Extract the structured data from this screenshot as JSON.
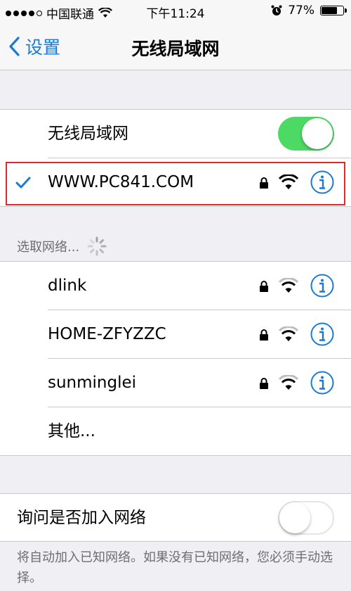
{
  "status_bar": {
    "carrier": "中国联通",
    "time": "下午11:24",
    "battery": "77%",
    "battery_level": 0.77
  },
  "nav": {
    "back_label": "设置",
    "title": "无线局域网"
  },
  "wifi_toggle": {
    "label": "无线局域网",
    "state": "on"
  },
  "connected_network": {
    "name": "WWW.PC841.COM",
    "secured": true,
    "connected": true
  },
  "choose_network": {
    "header": "选取网络...",
    "networks": [
      {
        "name": "dlink",
        "secured": true
      },
      {
        "name": "HOME-ZFYZZC",
        "secured": true
      },
      {
        "name": "sunminglei",
        "secured": true
      }
    ],
    "other_label": "其他..."
  },
  "ask_to_join": {
    "label": "询问是否加入网络",
    "state": "off",
    "description": "将自动加入已知网络。如果没有已知网络，您必须手动选择。"
  },
  "colors": {
    "accent": "#1a7ad6",
    "toggle_on": "#4cd964",
    "highlight_border": "#d32f2f"
  }
}
